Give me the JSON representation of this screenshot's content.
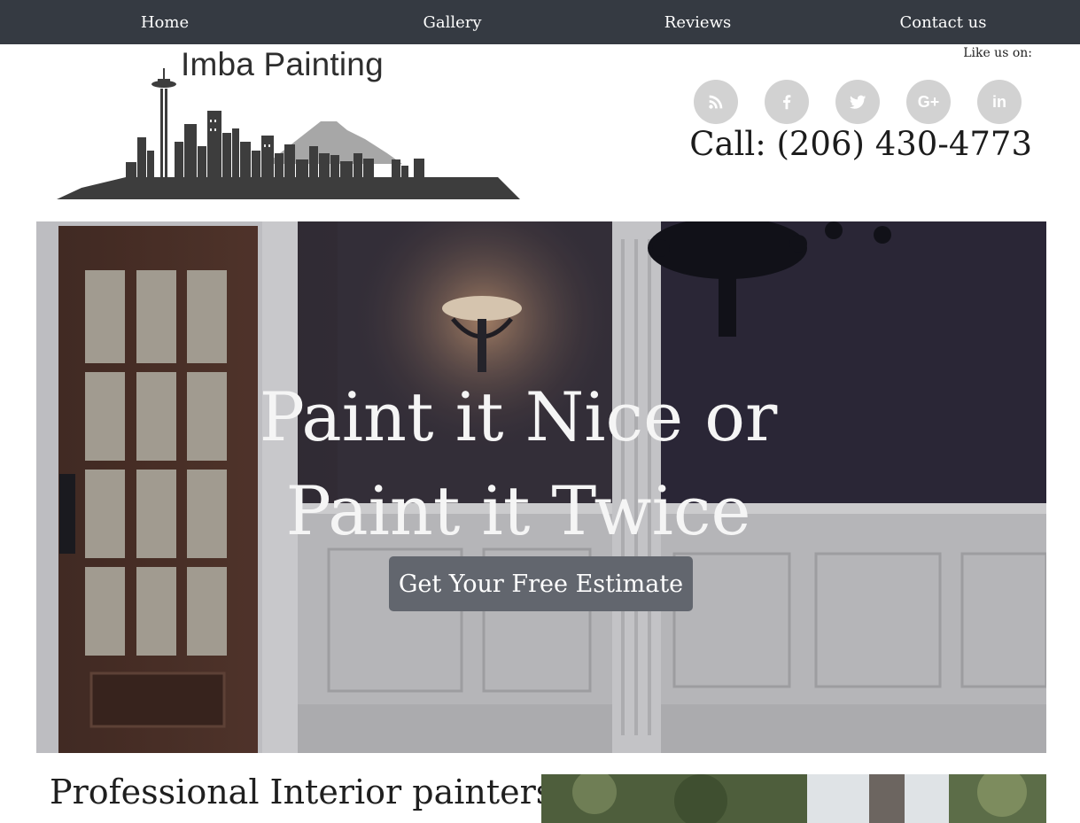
{
  "nav": {
    "items": [
      "Home",
      "Gallery",
      "Reviews",
      "Contact us"
    ]
  },
  "header": {
    "logo_text": "Imba Painting",
    "like_us": "Like us on:",
    "phone": "Call: (206) 430-4773",
    "social_icons": [
      "rss-icon",
      "facebook-icon",
      "twitter-icon",
      "google-plus-icon",
      "linkedin-icon"
    ]
  },
  "hero": {
    "headline_line1": "Paint it Nice or",
    "headline_line2": "Paint it Twice",
    "cta": "Get Your Free Estimate"
  },
  "section": {
    "title": "Professional Interior painters"
  },
  "colors": {
    "nav_bg": "#353a42",
    "social_bg": "#d2d2d2",
    "cta_bg": "#62666e"
  }
}
